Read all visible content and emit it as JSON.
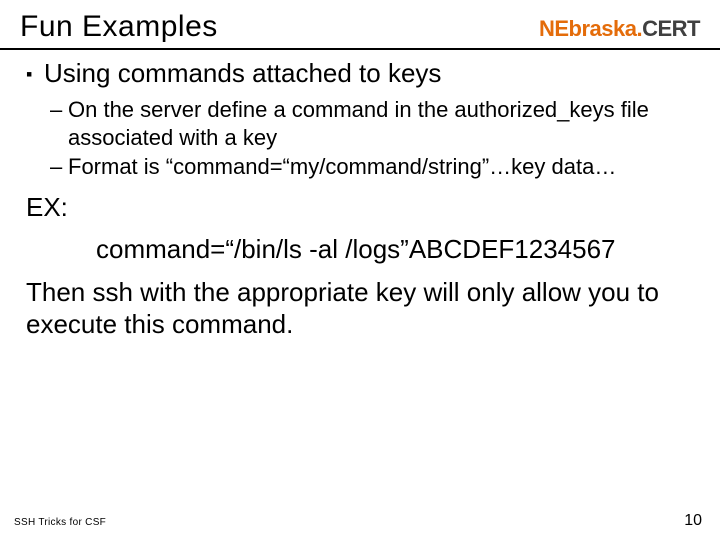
{
  "header": {
    "title": "Fun Examples",
    "brand_part1": "NEbraska.",
    "brand_part2": "CERT"
  },
  "content": {
    "bullet_main": "Using commands attached to keys",
    "sub1": "On the server define a command in the authorized_keys file associated with a key",
    "sub2": "Format is “command=“my/command/string”…key data…",
    "ex_label": "EX:",
    "ex_line": "command=“/bin/ls -al /logs”ABCDEF1234567",
    "ex_after": "Then ssh with the appropriate key will only allow you to execute this command."
  },
  "footer": {
    "left": "SSH Tricks for CSF",
    "page": "10"
  }
}
